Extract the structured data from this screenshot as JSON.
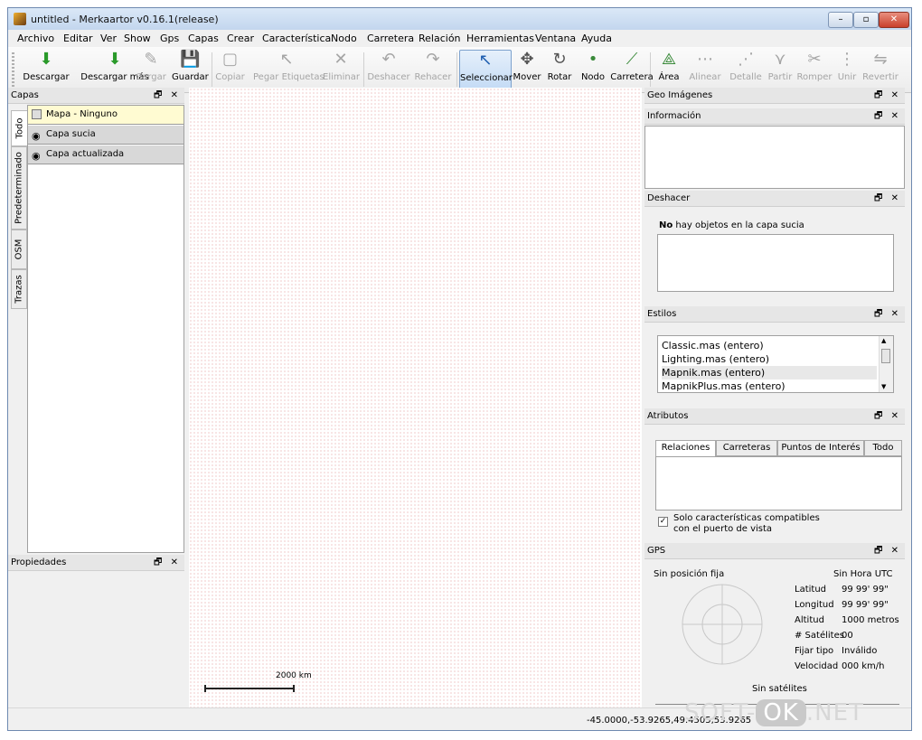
{
  "window": {
    "title": "untitled - Merkaartor v0.16.1(release)",
    "controls": [
      "–",
      "▫",
      "✕"
    ]
  },
  "menu": [
    "Archivo",
    "Editar",
    "Ver",
    "Show",
    "Gps",
    "Capas",
    "Crear",
    "Característica",
    "Nodo",
    "Carretera",
    "Relación",
    "Herramientas",
    "Ventana",
    "Ayuda"
  ],
  "toolbar": [
    {
      "label": "Descargar",
      "icon": "download-icon",
      "glyph": "⬇",
      "disabled": false
    },
    {
      "label": "Descargar más",
      "icon": "download-more-icon",
      "glyph": "⬇",
      "disabled": false
    },
    {
      "label": "Cargar",
      "icon": "load-icon",
      "glyph": "✎",
      "disabled": true
    },
    {
      "label": "Guardar",
      "icon": "save-icon",
      "glyph": "💾",
      "disabled": false
    },
    {
      "label": "Copiar",
      "icon": "copy-icon",
      "glyph": "▢",
      "disabled": true
    },
    {
      "label": "Pegar Etiquetas",
      "icon": "paste-tags-icon",
      "glyph": "↖",
      "disabled": true
    },
    {
      "label": "Eliminar",
      "icon": "delete-icon",
      "glyph": "✕",
      "disabled": true
    },
    {
      "label": "Deshacer",
      "icon": "undo-icon",
      "glyph": "↶",
      "disabled": true
    },
    {
      "label": "Rehacer",
      "icon": "redo-icon",
      "glyph": "↷",
      "disabled": true
    },
    {
      "label": "Seleccionar",
      "icon": "select-cursor-icon",
      "glyph": "↖",
      "disabled": false,
      "active": true
    },
    {
      "label": "Mover",
      "icon": "move-icon",
      "glyph": "✥",
      "disabled": false
    },
    {
      "label": "Rotar",
      "icon": "rotate-icon",
      "glyph": "↻",
      "disabled": false
    },
    {
      "label": "Nodo",
      "icon": "node-icon",
      "glyph": "•",
      "disabled": false
    },
    {
      "label": "Carretera",
      "icon": "road-icon",
      "glyph": "⟋",
      "disabled": false
    },
    {
      "label": "Área",
      "icon": "area-icon",
      "glyph": "⟁",
      "disabled": false
    },
    {
      "label": "Alinear",
      "icon": "align-icon",
      "glyph": "⋯",
      "disabled": true
    },
    {
      "label": "Detalle",
      "icon": "detail-icon",
      "glyph": "⋰",
      "disabled": true
    },
    {
      "label": "Partir",
      "icon": "split-icon",
      "glyph": "⋎",
      "disabled": true
    },
    {
      "label": "Romper",
      "icon": "break-icon",
      "glyph": "✂",
      "disabled": true
    },
    {
      "label": "Unir",
      "icon": "join-icon",
      "glyph": "⋮",
      "disabled": true
    },
    {
      "label": "Revertir",
      "icon": "revert-icon",
      "glyph": "⇋",
      "disabled": true
    }
  ],
  "layers_dock": {
    "title": "Capas",
    "tabs": [
      "Todo",
      "Predeterminado",
      "OSM",
      "Trazas"
    ],
    "layers": [
      "Mapa - Ninguno",
      "Capa sucia",
      "Capa actualizada"
    ]
  },
  "properties_dock": {
    "title": "Propiedades"
  },
  "map": {
    "scale_label": "2000 km"
  },
  "geo_images": {
    "title": "Geo Imágenes"
  },
  "info": {
    "title": "Información"
  },
  "undo": {
    "title": "Deshacer",
    "message_bold": "No",
    "message_rest": " hay objetos en la capa sucia"
  },
  "styles": {
    "title": "Estilos",
    "items": [
      "Classic.mas (entero)",
      "Lighting.mas (entero)",
      "Mapnik.mas (entero)",
      "MapnikPlus.mas (entero)"
    ],
    "selected_index": 2
  },
  "attributes": {
    "title": "Atributos",
    "tabs": [
      "Relaciones",
      "Carreteras",
      "Puntos de Interés",
      "Todo"
    ],
    "checkbox_label": "Solo características compatibles con el puerto de vista",
    "checkbox_checked": true
  },
  "gps": {
    "title": "GPS",
    "fix_status": "Sin posición fija",
    "utc": "Sin Hora UTC",
    "rows": [
      {
        "label": "Latitud",
        "value": "99 99' 99\""
      },
      {
        "label": "Longitud",
        "value": "99 99' 99\""
      },
      {
        "label": "Altitud",
        "value": "1000 metros"
      },
      {
        "label": "# Satélites",
        "value": "00"
      },
      {
        "label": "Fijar tipo",
        "value": "Inválido"
      },
      {
        "label": "Velocidad",
        "value": "000 km/h"
      }
    ],
    "satellites": "Sin satélites"
  },
  "status": {
    "coords": "-45.0000,-53.9265,49.4505,53.9265"
  },
  "watermark": {
    "left": "SOFT-",
    "mid": "OK",
    "right": ".NET"
  },
  "dock_controls": "🗗 ✕"
}
